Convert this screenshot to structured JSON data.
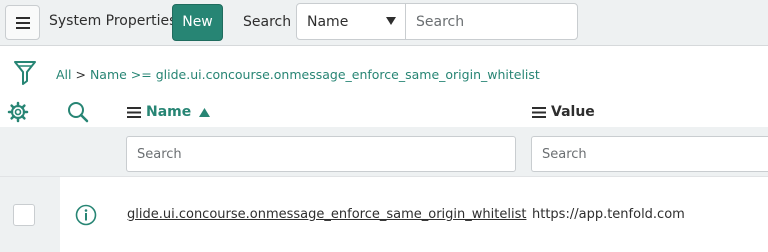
{
  "header": {
    "title": "System Properties",
    "new_label": "New",
    "search_label": "Search",
    "search_field": "Name",
    "search_placeholder": "Search"
  },
  "breadcrumb": {
    "all": "All",
    "separator": ">",
    "filter": "Name >= glide.ui.concourse.onmessage_enforce_same_origin_whitelist"
  },
  "table": {
    "columns": [
      {
        "label": "Name",
        "sort": "ascending",
        "search_placeholder": "Search"
      },
      {
        "label": "Value",
        "search_placeholder": "Search"
      }
    ],
    "rows": [
      {
        "name": "glide.ui.concourse.onmessage_enforce_same_origin_whitelist",
        "value": "https://app.tenfold.com"
      }
    ]
  },
  "colors": {
    "accent": "#278574",
    "header_bg": "#eef1f2",
    "text": "#2e2e2e"
  }
}
